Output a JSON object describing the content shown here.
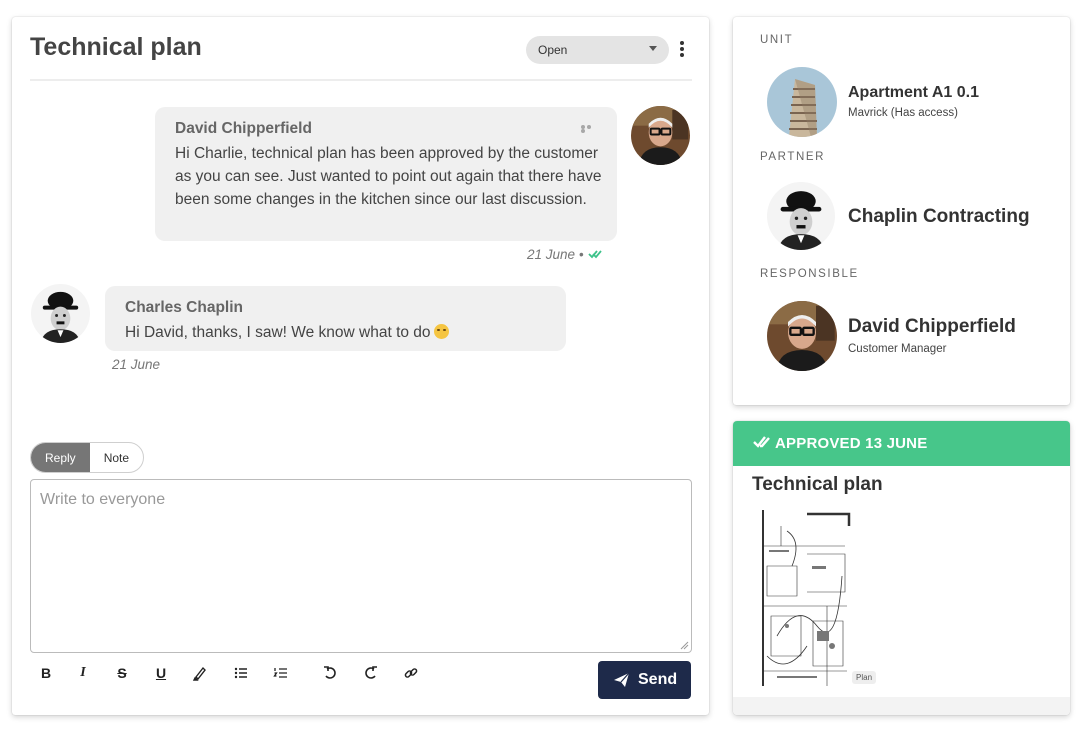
{
  "chat": {
    "title": "Technical plan",
    "status_value": "Open",
    "messages": [
      {
        "author": "David Chipperfield",
        "text": "Hi Charlie, technical plan has been approved by the customer as you can see. Just wanted to point out again that there have been some changes in the kitchen since our last discussion.",
        "date": "21 June",
        "separator": "•"
      },
      {
        "author": "Charles Chaplin",
        "text": "Hi David, thanks, I saw! We know what to do",
        "date": "21 June"
      }
    ],
    "tabs": [
      "Reply",
      "Note"
    ],
    "composer_placeholder": "Write to everyone",
    "send_label": "Send",
    "toolbar_glyphs": {
      "bold": "B",
      "italic": "I",
      "strike": "S",
      "underline": "U"
    }
  },
  "info": {
    "unit_label": "UNIT",
    "unit_name": "Apartment A1 0.1",
    "unit_sub": "Mavrick (Has access)",
    "partner_label": "PARTNER",
    "partner_name": "Chaplin Contracting",
    "responsible_label": "RESPONSIBLE",
    "responsible_name": "David Chipperfield",
    "responsible_sub": "Customer Manager"
  },
  "approval": {
    "banner": "APPROVED 13 JUNE",
    "title": "Technical plan",
    "thumb_chip": "Plan"
  },
  "colors": {
    "approved_green": "#47c68a",
    "send_navy": "#1e2a4a",
    "read_check": "#3cc28a",
    "bubble_bg": "#f0f0f0"
  }
}
